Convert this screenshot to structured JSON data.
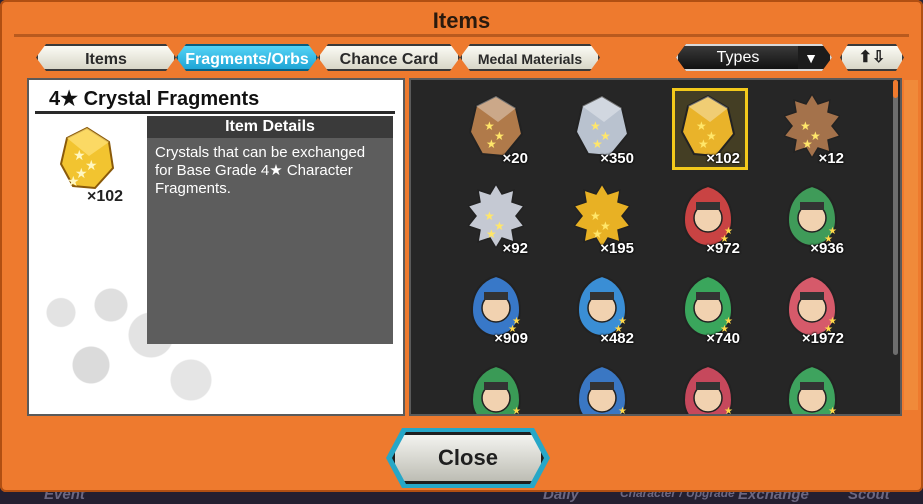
{
  "dialog": {
    "title": "Items",
    "close_label": "Close"
  },
  "tabs": [
    {
      "label": "Items",
      "active": false
    },
    {
      "label": "Fragments/Orbs",
      "active": true
    },
    {
      "label": "Chance Card",
      "active": false
    },
    {
      "label": "Medal Materials",
      "active": false
    }
  ],
  "filter": {
    "types_label": "Types",
    "sort_icon": "sort-up-down-icon"
  },
  "selected_item": {
    "name": "4★ Crystal Fragments",
    "count": "×102",
    "details_header": "Item Details",
    "description": "Crystals that can be exchanged for Base Grade 4★ Character Fragments."
  },
  "grid": [
    {
      "icon": "bronze-crystal-icon",
      "count": "×20",
      "color": "#b07a4a",
      "selected": false
    },
    {
      "icon": "silver-crystal-icon",
      "count": "×350",
      "color": "#b9c2cf",
      "selected": false
    },
    {
      "icon": "gold-crystal-icon",
      "count": "×102",
      "color": "#e9b32a",
      "selected": true
    },
    {
      "icon": "bronze-spiky-crystal-icon",
      "count": "×12",
      "color": "#a4724b",
      "selected": false
    },
    {
      "icon": "silver-spiky-crystal-icon",
      "count": "×92",
      "color": "#c5c9d3",
      "selected": false
    },
    {
      "icon": "gold-spiky-crystal-icon",
      "count": "×195",
      "color": "#e8b124",
      "selected": false
    },
    {
      "icon": "character-fragment-red-icon",
      "count": "×972",
      "color": "#c94343",
      "selected": false
    },
    {
      "icon": "character-fragment-green-icon",
      "count": "×936",
      "color": "#3f9b59",
      "selected": false
    },
    {
      "icon": "character-fragment-blue-icon",
      "count": "×909",
      "color": "#3878c8",
      "selected": false
    },
    {
      "icon": "character-fragment-blue2-icon",
      "count": "×482",
      "color": "#3a8ed5",
      "selected": false
    },
    {
      "icon": "character-fragment-green2-icon",
      "count": "×740",
      "color": "#3aa65c",
      "selected": false
    },
    {
      "icon": "character-fragment-red2-icon",
      "count": "×1972",
      "color": "#d65a6a",
      "selected": false
    },
    {
      "icon": "character-fragment-green3-icon",
      "count": "",
      "color": "#3a9a56",
      "selected": false
    },
    {
      "icon": "character-fragment-blue3-icon",
      "count": "",
      "color": "#3a77c3",
      "selected": false
    },
    {
      "icon": "character-fragment-red3-icon",
      "count": "",
      "color": "#c6485c",
      "selected": false
    },
    {
      "icon": "character-fragment-green4-icon",
      "count": "",
      "color": "#3ea35e",
      "selected": false
    }
  ],
  "bottom_nav": [
    "Event",
    "Daily",
    "Character / Upgrade",
    "Exchange",
    "Scout"
  ]
}
